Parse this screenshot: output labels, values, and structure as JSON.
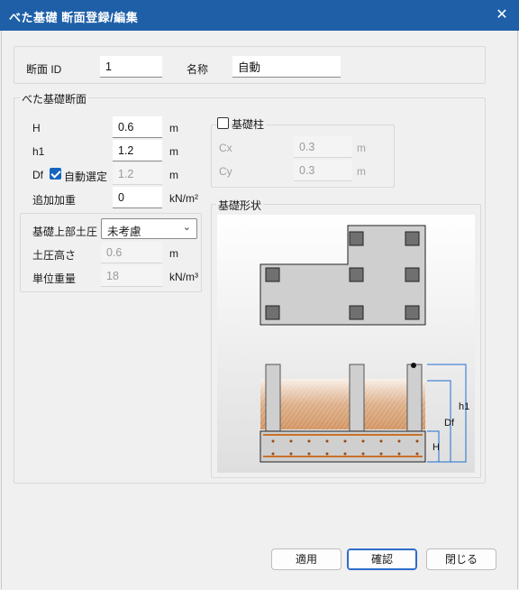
{
  "window": {
    "title": "べた基礎 断面登録/編集",
    "close_glyph": "✕"
  },
  "header": {
    "id_label": "断面 ID",
    "id_value": "1",
    "name_label": "名称",
    "name_value": "自動"
  },
  "section": {
    "legend": "べた基礎断面",
    "H": {
      "label": "H",
      "value": "0.6",
      "unit": "m"
    },
    "h1": {
      "label": "h1",
      "value": "1.2",
      "unit": "m"
    },
    "Df": {
      "label": "Df",
      "auto_label": "自動選定",
      "auto_checked": true,
      "value": "1.2",
      "unit": "m"
    },
    "load": {
      "label": "追加加重",
      "value": "0",
      "unit": "kN/m²"
    }
  },
  "soil": {
    "pressure_label": "基礎上部土圧",
    "pressure_value": "未考慮",
    "height_label": "土圧高さ",
    "height_value": "0.6",
    "height_unit": "m",
    "weight_label": "単位重量",
    "weight_value": "18",
    "weight_unit": "kN/m³"
  },
  "column": {
    "label": "基礎柱",
    "checked": false,
    "cx_label": "Cx",
    "cx_value": "0.3",
    "cx_unit": "m",
    "cy_label": "Cy",
    "cy_value": "0.3",
    "cy_unit": "m"
  },
  "shape": {
    "legend": "基礎形状",
    "dim_labels": {
      "h1": "h1",
      "Df": "Df",
      "H": "H"
    },
    "colors": {
      "slab": "#cfcfcf",
      "column": "#707070",
      "soil": "#d9a77a",
      "rebar": "#c8722a",
      "dim": "#1f6fd1"
    }
  },
  "buttons": {
    "apply": "適用",
    "ok": "確認",
    "close": "閉じる"
  }
}
